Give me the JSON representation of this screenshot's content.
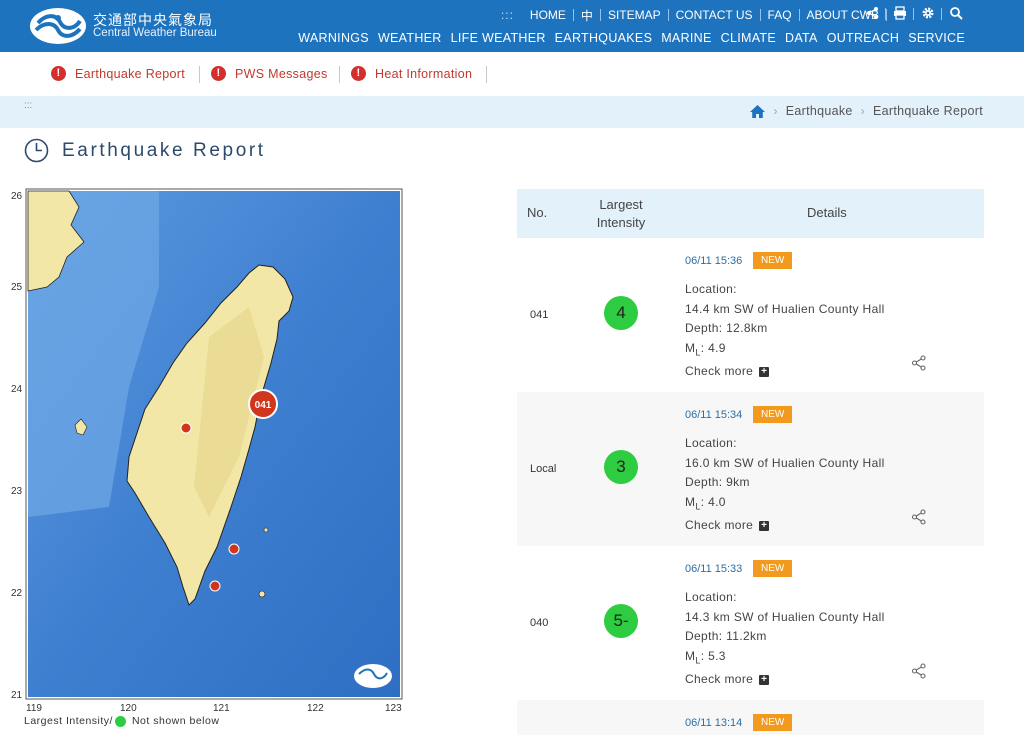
{
  "header": {
    "logo_icon": "cwb-logo",
    "brand_zh": "交通部中央氣象局",
    "brand_en": "Central Weather Bureau",
    "top_dots": ":::",
    "top_links": [
      "HOME",
      "中",
      "SITEMAP",
      "CONTACT US",
      "FAQ",
      "ABOUT CWB"
    ],
    "top_icons": [
      "share-icon",
      "print-icon",
      "gear-icon",
      "search-icon"
    ],
    "main_nav": [
      "WARNINGS",
      "WEATHER",
      "LIFE WEATHER",
      "EARTHQUAKES",
      "MARINE",
      "CLIMATE",
      "DATA",
      "OUTREACH",
      "SERVICE"
    ]
  },
  "subnav": {
    "items": [
      "Earthquake Report",
      "PWS Messages",
      "Heat Information"
    ],
    "icon": "alert-icon"
  },
  "breadcrumb": {
    "dots": ":::",
    "home_icon": "home-icon",
    "items": [
      "Earthquake",
      "Earthquake Report"
    ]
  },
  "page": {
    "title": "Earthquake Report",
    "title_icon": "clock-icon"
  },
  "map": {
    "y_ticks": [
      "26",
      "25",
      "24",
      "23",
      "22",
      "21"
    ],
    "x_ticks": [
      "119",
      "120",
      "121",
      "122",
      "123"
    ],
    "marker_label": "041",
    "legend_label": "Largest Intensity/",
    "legend_note": "Not shown below",
    "colors": {
      "sea": "#3f7fd0",
      "land": "#f2e7a6",
      "marker": "#d0361b"
    }
  },
  "table": {
    "headers": {
      "no": "No.",
      "intensity": "Largest Intensity",
      "details": "Details"
    },
    "location_label": "Location:",
    "depth_label": "Depth:",
    "ml_label": "M",
    "ml_sub": "L",
    "check_more": "Check more",
    "new_badge": "NEW",
    "rows": [
      {
        "no": "041",
        "intensity": "4",
        "time": "06/11 15:36",
        "location": "14.4 km SW of Hualien County Hall",
        "depth": "12.8km",
        "ml": "4.9"
      },
      {
        "no": "Local",
        "intensity": "3",
        "time": "06/11 15:34",
        "location": "16.0 km SW of Hualien County Hall",
        "depth": "9km",
        "ml": "4.0"
      },
      {
        "no": "040",
        "intensity": "5-",
        "time": "06/11 15:33",
        "location": "14.3 km SW of Hualien County Hall",
        "depth": "11.2km",
        "ml": "5.3"
      },
      {
        "time": "06/11 13:14"
      }
    ],
    "colors": {
      "intensity_ball": "#2ecc40",
      "new_badge": "#f29a1d",
      "header_bg": "#e3f1fb"
    }
  }
}
